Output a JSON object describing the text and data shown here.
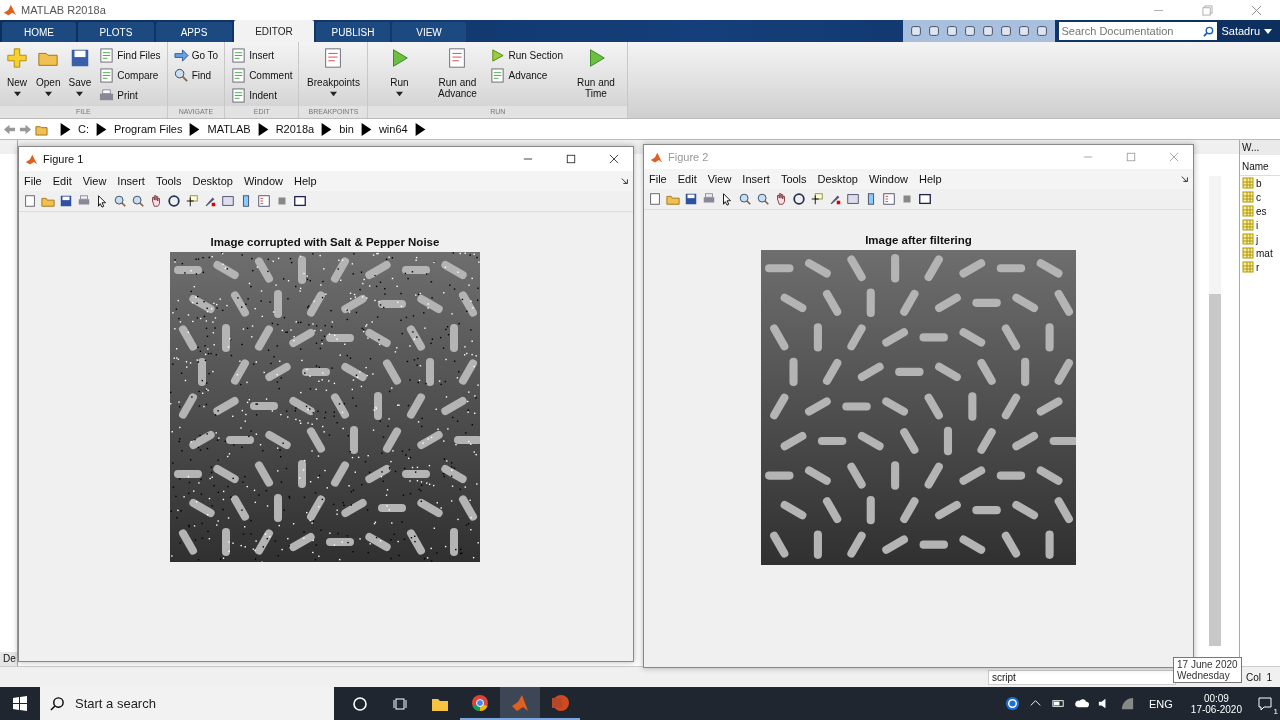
{
  "window": {
    "title": "MATLAB R2018a"
  },
  "tabs": [
    {
      "label": "HOME",
      "selected": false
    },
    {
      "label": "PLOTS",
      "selected": false
    },
    {
      "label": "APPS",
      "selected": false
    },
    {
      "label": "EDITOR",
      "selected": true
    },
    {
      "label": "PUBLISH",
      "selected": false
    },
    {
      "label": "VIEW",
      "selected": false
    }
  ],
  "search": {
    "placeholder": "Search Documentation"
  },
  "user": "Satadru",
  "ribbon": [
    {
      "label": "FILE",
      "items": [
        {
          "label": "New",
          "kind": "large"
        },
        {
          "label": "Open",
          "kind": "large"
        },
        {
          "label": "Save",
          "kind": "large"
        },
        {
          "label": "Find Files",
          "kind": "small"
        },
        {
          "label": "Compare",
          "kind": "small"
        },
        {
          "label": "Print",
          "kind": "small"
        }
      ]
    },
    {
      "label": "NAVIGATE",
      "items": [
        {
          "label": "Go To",
          "kind": "small"
        },
        {
          "label": "Find",
          "kind": "small"
        }
      ]
    },
    {
      "label": "EDIT",
      "items": [
        {
          "label": "Insert",
          "kind": "small"
        },
        {
          "label": "Comment",
          "kind": "small"
        },
        {
          "label": "Indent",
          "kind": "small"
        }
      ]
    },
    {
      "label": "BREAKPOINTS",
      "items": [
        {
          "label": "Breakpoints",
          "kind": "large"
        }
      ]
    },
    {
      "label": "RUN",
      "items": [
        {
          "label": "Run",
          "kind": "large"
        },
        {
          "label": "Run and Advance",
          "kind": "large"
        },
        {
          "label": "Run Section",
          "kind": "small"
        },
        {
          "label": "Advance",
          "kind": "small"
        },
        {
          "label": "Run and Time",
          "kind": "large"
        }
      ]
    }
  ],
  "path": [
    "C:",
    "Program Files",
    "MATLAB",
    "R2018a",
    "bin",
    "win64"
  ],
  "panels": {
    "bottom_tab": "De"
  },
  "workspace": {
    "title": "W...",
    "column": "Name",
    "variables": [
      "b",
      "c",
      "es",
      "i",
      "j",
      "mat",
      "r"
    ]
  },
  "figures": [
    {
      "title": "Figure 1",
      "active": true,
      "menu": [
        "File",
        "Edit",
        "View",
        "Insert",
        "Tools",
        "Desktop",
        "Window",
        "Help"
      ],
      "plot_title": "Image corrupted with Salt & Pepper Noise",
      "noisy": true
    },
    {
      "title": "Figure 2",
      "active": false,
      "menu": [
        "File",
        "Edit",
        "View",
        "Insert",
        "Tools",
        "Desktop",
        "Window",
        "Help"
      ],
      "plot_title": "Image after filtering",
      "noisy": false
    }
  ],
  "status_bar": {
    "type": "script",
    "col_label": "Col",
    "col": "1"
  },
  "tooltip": [
    "17 June 2020",
    "Wednesday"
  ],
  "taskbar": {
    "search_placeholder": "Start a search",
    "apps": [
      {
        "kind": "explorer",
        "running": false,
        "selected": false
      },
      {
        "kind": "chrome",
        "running": true,
        "selected": false
      },
      {
        "kind": "matlab",
        "running": true,
        "selected": true
      },
      {
        "kind": "powerpoint",
        "running": true,
        "selected": false
      }
    ],
    "language": "ENG",
    "time": "00:09",
    "date": "17-06-2020",
    "notifications": "1"
  }
}
